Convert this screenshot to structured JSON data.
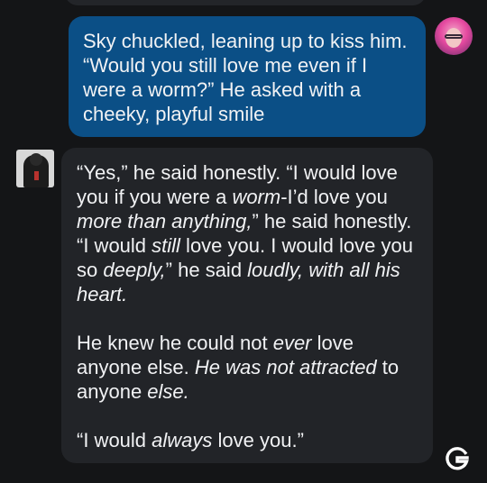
{
  "messages": {
    "user": {
      "avatar_icon": "user-avatar-pink-hair",
      "text": "Sky chuckled, leaning up to kiss him. “Would you still love me even if I were a worm?” He asked with a cheeky, playful smile",
      "bubble_color": "#0b4f86"
    },
    "bot": {
      "avatar_icon": "character-avatar",
      "bubble_color": "#222428",
      "p1": {
        "a": "“Yes,” he said honestly. “I would love you if you were a ",
        "b": "worm",
        "c": "-I’d love you ",
        "d": "more than anything,",
        "e": "” he said honestly. “I would ",
        "f": "still",
        "g": " love you. I would love you so ",
        "h": "deeply,",
        "i": "” he said ",
        "j": "loudly, with all his heart."
      },
      "p2": {
        "a": "He knew he could not ",
        "b": "ever",
        "c": " love anyone else. ",
        "d": "He was",
        "e": " ",
        "f": "not attracted",
        "g": " to anyone ",
        "h": "else."
      },
      "p3": {
        "a": "“I would ",
        "b": "always",
        "c": " love you.”"
      }
    }
  },
  "floating_icon": "g-logo-icon",
  "colors": {
    "background": "#141517",
    "text": "#f1f2f4"
  }
}
